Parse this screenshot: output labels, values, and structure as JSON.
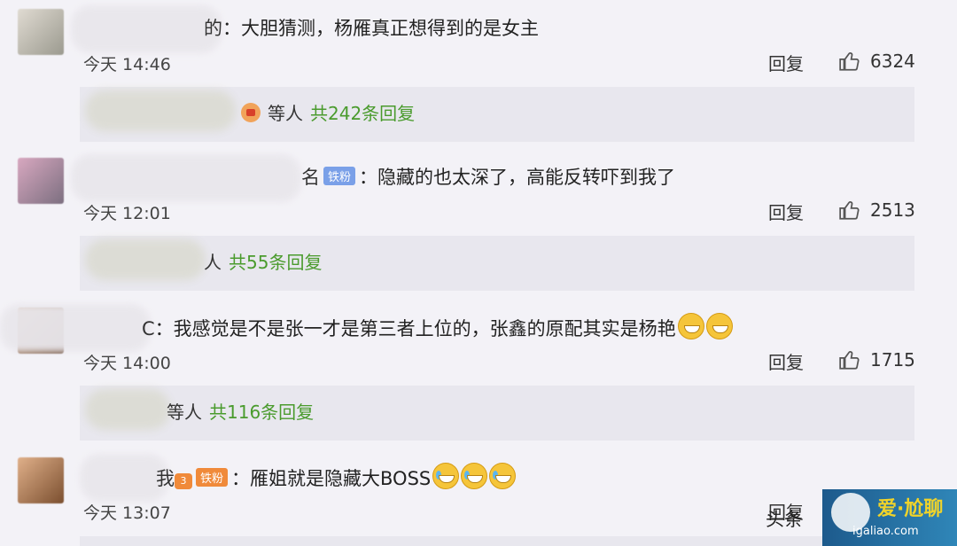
{
  "comments": [
    {
      "name_visible": "的",
      "badge": "",
      "text": "大胆猜测，杨雁真正想得到的是女主",
      "time": "今天 14:46",
      "reply_label": "回复",
      "likes": "6324",
      "replies": {
        "others": "等人",
        "count": "共242条回复"
      }
    },
    {
      "name_visible": "名",
      "badge": "铁粉",
      "text": "隐藏的也太深了，高能反转吓到我了",
      "time": "今天 12:01",
      "reply_label": "回复",
      "likes": "2513",
      "replies": {
        "others": "人",
        "count": "共55条回复"
      }
    },
    {
      "name_visible": "C",
      "badge": "",
      "text": "我感觉是不是张一才是第三者上位的，张鑫的原配其实是杨艳",
      "time": "今天 14:00",
      "reply_label": "回复",
      "likes": "1715",
      "replies": {
        "others": "等人",
        "count": "共116条回复"
      }
    },
    {
      "name_visible": "我",
      "badge": "铁粉",
      "text": "雁姐就是隐藏大BOSS",
      "time": "今天 13:07",
      "reply_label": "回复",
      "likes": "",
      "replies": null
    }
  ],
  "badge_level": "3",
  "watermark": {
    "brand": "头条",
    "title": "爱·尬聊",
    "url": "igaliao.com"
  },
  "colors": {
    "reply_count": "#4a9b2d",
    "fan_badge": "#7aa0e8",
    "background": "#f3f2f7"
  }
}
